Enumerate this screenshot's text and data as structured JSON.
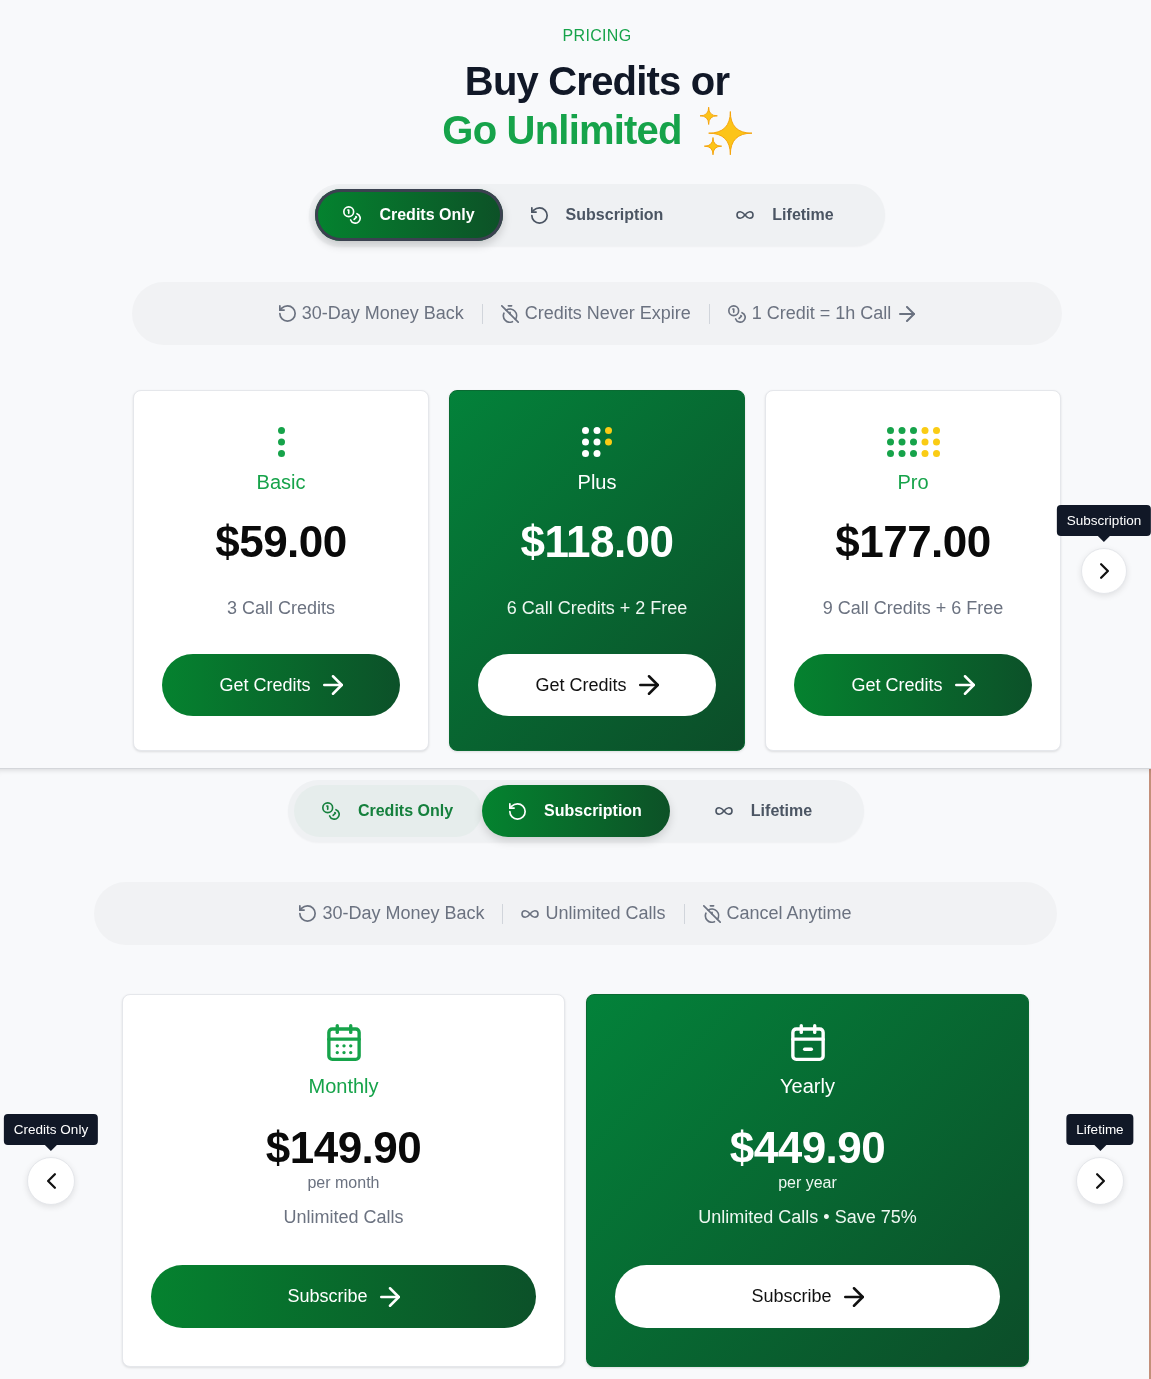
{
  "header": {
    "eyebrow": "PRICING",
    "title": "Buy Credits or",
    "highlight": "Go Unlimited"
  },
  "sections": [
    {
      "kind": "credits",
      "tabs": [
        {
          "label": "Credits Only",
          "selected": true,
          "focused": true,
          "hovered": false
        },
        {
          "label": "Subscription",
          "selected": false,
          "focused": false,
          "hovered": false
        },
        {
          "label": "Lifetime",
          "selected": false,
          "focused": false,
          "hovered": false
        }
      ],
      "features": [
        {
          "kind": "refund",
          "text": "30-Day Money Back",
          "link": false
        },
        {
          "kind": "expiry",
          "text": "Credits Never Expire",
          "link": false
        },
        {
          "kind": "rate",
          "text": "1 Credit = 1h Call",
          "link": true
        }
      ],
      "plans": [
        {
          "name": "Basic",
          "price": "$59.00",
          "description": "3 Call Credits",
          "button": "Get Credits",
          "featured": false
        },
        {
          "name": "Plus",
          "price": "$118.00",
          "description": "6 Call Credits + 2 Free",
          "button": "Get Credits",
          "featured": true
        },
        {
          "name": "Pro",
          "price": "$177.00",
          "description": "9 Call Credits + 6 Free",
          "button": "Get Credits",
          "featured": false
        }
      ],
      "nav": [
        {
          "kind": "next",
          "tooltip": "Subscription"
        }
      ]
    },
    {
      "kind": "subscription",
      "tabs": [
        {
          "label": "Credits Only",
          "selected": false,
          "focused": false,
          "hovered": true
        },
        {
          "label": "Subscription",
          "selected": true,
          "focused": false,
          "hovered": false
        },
        {
          "label": "Lifetime",
          "selected": false,
          "focused": false,
          "hovered": false
        }
      ],
      "features": [
        {
          "kind": "refund",
          "text": "30-Day Money Back",
          "link": false
        },
        {
          "kind": "unlimited",
          "text": "Unlimited Calls",
          "link": false
        },
        {
          "kind": "cancel",
          "text": "Cancel Anytime",
          "link": false
        }
      ],
      "plans": [
        {
          "name": "Monthly",
          "price": "$149.90",
          "period": "per month",
          "description": "Unlimited Calls",
          "button": "Subscribe",
          "featured": false
        },
        {
          "name": "Yearly",
          "price": "$449.90",
          "period": "per year",
          "description": "Unlimited Calls • Save 75%",
          "button": "Subscribe",
          "featured": true
        }
      ],
      "nav": [
        {
          "kind": "prev",
          "tooltip": "Credits Only"
        },
        {
          "kind": "next",
          "tooltip": "Lifetime"
        }
      ]
    }
  ]
}
